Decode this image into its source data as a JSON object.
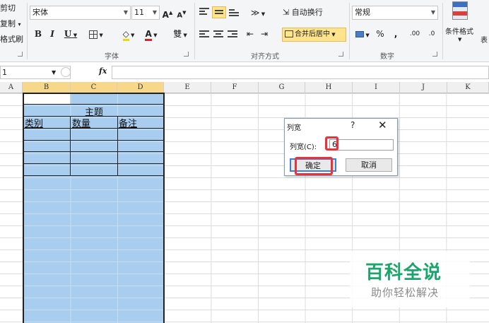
{
  "clipboard": {
    "cut_label": "剪切",
    "copy_label": "复制",
    "copy_arrow": "▾",
    "format_painter_label": "格式刷"
  },
  "font": {
    "name": "宋体",
    "size": "11",
    "grow_label": "A",
    "shrink_label": "A",
    "bold_label": "B",
    "italic_label": "I",
    "underline_label": "U",
    "fill_label": "◇",
    "color_label": "A",
    "pinyin_label": "雙",
    "group_label": "字体"
  },
  "alignment": {
    "wrap_label": "自动换行",
    "merge_label": "合并后居中",
    "group_label": "对齐方式"
  },
  "number": {
    "format": "常规",
    "percent_label": "%",
    "comma_label": ",",
    "inc_decimal_label": ".00",
    "dec_decimal_label": ".0",
    "group_label": "数字"
  },
  "styles": {
    "conditional_label": "条件格式",
    "table_label": "表"
  },
  "formula_bar": {
    "name_box": "1",
    "fx_label": "fx"
  },
  "columns": [
    "A",
    "B",
    "C",
    "D",
    "E",
    "F",
    "G",
    "H",
    "I",
    "J",
    "K"
  ],
  "table": {
    "title": "主题",
    "headers": [
      "类别",
      "数量",
      "备注"
    ]
  },
  "dialog": {
    "title": "列宽",
    "help": "?",
    "close": "✕",
    "field_label": "列宽(C):",
    "field_value": "6",
    "ok_label": "确定",
    "cancel_label": "取消"
  },
  "watermark": {
    "title": "百科全说",
    "subtitle": "助你轻松解决"
  },
  "colors": {
    "selection": "#a8cdee",
    "highlight": "#ffe48c",
    "annotation_red": "#e8323c",
    "watermark_green": "#1aa56a"
  }
}
